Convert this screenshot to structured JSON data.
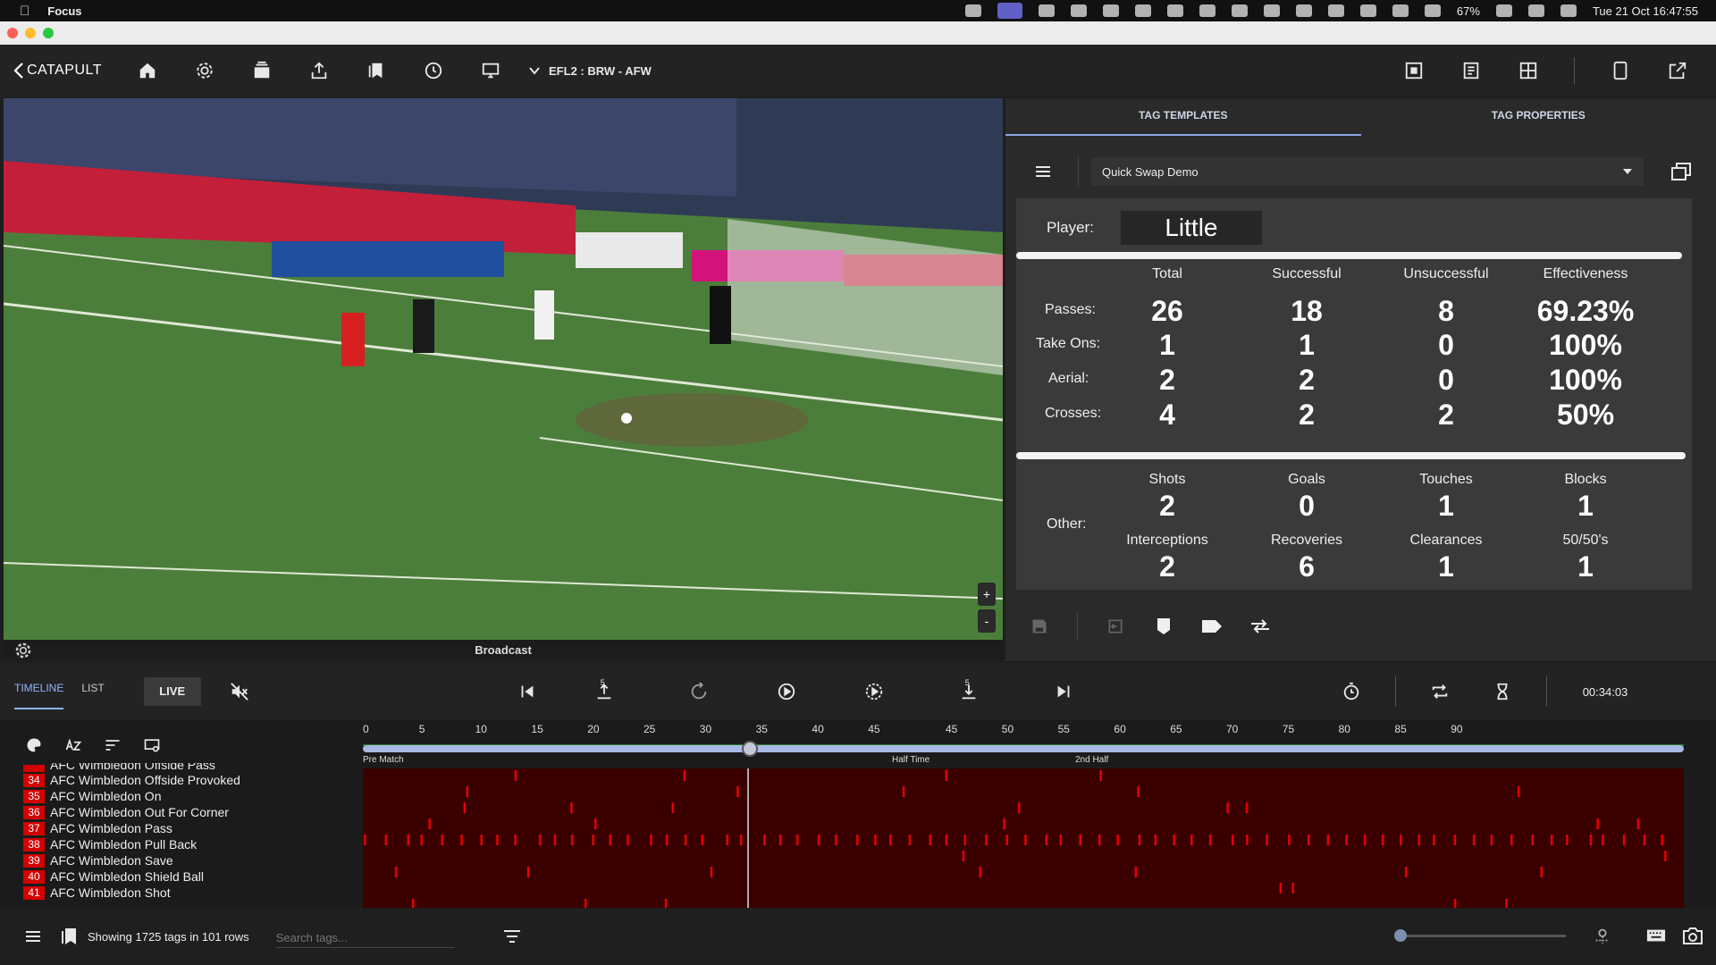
{
  "macbar": {
    "app_name": "Focus",
    "battery": "67%",
    "datetime": "Tue 21 Oct  16:47:55"
  },
  "toolbar": {
    "logo": "CATAPULT",
    "match": "EFL2 : BRW - AFW"
  },
  "video": {
    "source_label": "Broadcast",
    "zoom_in": "+",
    "zoom_out": "-"
  },
  "panel": {
    "tabs": [
      "TAG TEMPLATES",
      "TAG PROPERTIES"
    ],
    "template_selected": "Quick Swap Demo",
    "player_label": "Player:",
    "player_name": "Little",
    "headers": [
      "Total",
      "Successful",
      "Unsuccessful",
      "Effectiveness"
    ],
    "rows": [
      {
        "label": "Passes:",
        "values": [
          "26",
          "18",
          "8",
          "69.23%"
        ]
      },
      {
        "label": "Take Ons:",
        "values": [
          "1",
          "1",
          "0",
          "100%"
        ]
      },
      {
        "label": "Aerial:",
        "values": [
          "2",
          "2",
          "0",
          "100%"
        ]
      },
      {
        "label": "Crosses:",
        "values": [
          "4",
          "2",
          "2",
          "50%"
        ]
      }
    ],
    "other_label": "Other:",
    "other_top": [
      {
        "label": "Shots",
        "value": "2"
      },
      {
        "label": "Goals",
        "value": "0"
      },
      {
        "label": "Touches",
        "value": "1"
      },
      {
        "label": "Blocks",
        "value": "1"
      }
    ],
    "other_bottom": [
      {
        "label": "Interceptions",
        "value": "2"
      },
      {
        "label": "Recoveries",
        "value": "6"
      },
      {
        "label": "Clearances",
        "value": "1"
      },
      {
        "label": "50/50's",
        "value": "1"
      }
    ]
  },
  "timeline": {
    "tabs": [
      "TIMELINE",
      "LIST"
    ],
    "live_label": "LIVE",
    "skip_back_label": "5",
    "skip_fwd_label": "5",
    "time": "00:34:03",
    "ticks_first": [
      "0",
      "5",
      "10",
      "15",
      "20",
      "25",
      "30",
      "35",
      "40",
      "45"
    ],
    "ticks_second": [
      "45",
      "50",
      "55",
      "60",
      "65",
      "70",
      "75",
      "80",
      "85",
      "90"
    ],
    "period_labels": [
      "Pre Match",
      "Half Time",
      "2nd Half"
    ],
    "playhead_minute": 34,
    "partial_row": "AFC Wimbledon Offside Pass",
    "rows": [
      {
        "num": "34",
        "label": "AFC Wimbledon Offside Provoked"
      },
      {
        "num": "35",
        "label": "AFC Wimbledon On"
      },
      {
        "num": "36",
        "label": "AFC Wimbledon Out For Corner"
      },
      {
        "num": "37",
        "label": "AFC Wimbledon Pass"
      },
      {
        "num": "38",
        "label": "AFC Wimbledon Pull Back"
      },
      {
        "num": "39",
        "label": "AFC Wimbledon Save"
      },
      {
        "num": "40",
        "label": "AFC Wimbledon Shield Ball"
      },
      {
        "num": "41",
        "label": "AFC Wimbledon Shot"
      }
    ]
  },
  "footer": {
    "count_text": "Showing 1725 tags in 101 rows",
    "search_placeholder": "Search tags..."
  },
  "colors": {
    "accent": "#8fb3ff",
    "tag_row": "#d40000",
    "timeline_bg": "#3a0000"
  }
}
